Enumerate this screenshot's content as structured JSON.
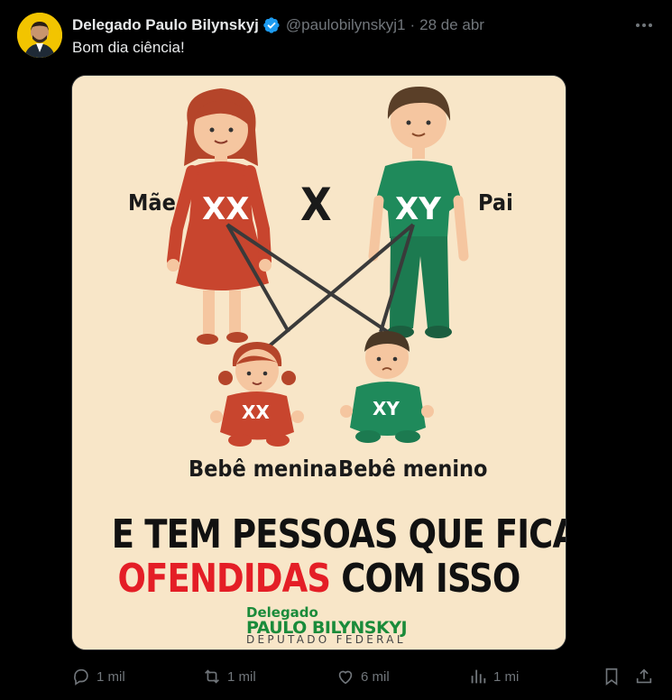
{
  "post": {
    "author_name": "Delegado Paulo Bilynskyj",
    "handle": "@paulobilynskyj1",
    "separator": "·",
    "date": "28 de abr",
    "text": "Bom dia ciência!"
  },
  "image": {
    "label_mother": "Mãe",
    "label_father": "Pai",
    "cross_symbol": "X",
    "mother_chromosomes": "XX",
    "father_chromosomes": "XY",
    "girl_chromosomes": "XX",
    "boy_chromosomes": "XY",
    "label_girl": "Bebê menina",
    "label_boy": "Bebê menino",
    "headline_line1": "E TEM PESSOAS QUE FICAM",
    "headline_red": "OFENDIDAS",
    "headline_rest": "COM ISSO",
    "brand_line1": "Delegado",
    "brand_line2": "PAULO BILYNSKYJ",
    "brand_line3": "DEPUTADO FEDERAL"
  },
  "actions": {
    "reply_count": "1 mil",
    "repost_count": "1 mil",
    "like_count": "6 mil",
    "views_count": "1 mi"
  },
  "colors": {
    "background": "#000000",
    "text_primary": "#e7e9ea",
    "text_secondary": "#71767b",
    "verified": "#1d9bf0",
    "poster_bg": "#f8e6c8",
    "mother_dress": "#c8452e",
    "father_shirt": "#1f8a5b",
    "headline_red": "#e41e26",
    "brand_green": "#1a8b3a"
  },
  "icons": [
    "verified-badge-icon",
    "more-icon",
    "reply-icon",
    "repost-icon",
    "like-icon",
    "views-icon",
    "bookmark-icon",
    "share-icon"
  ]
}
